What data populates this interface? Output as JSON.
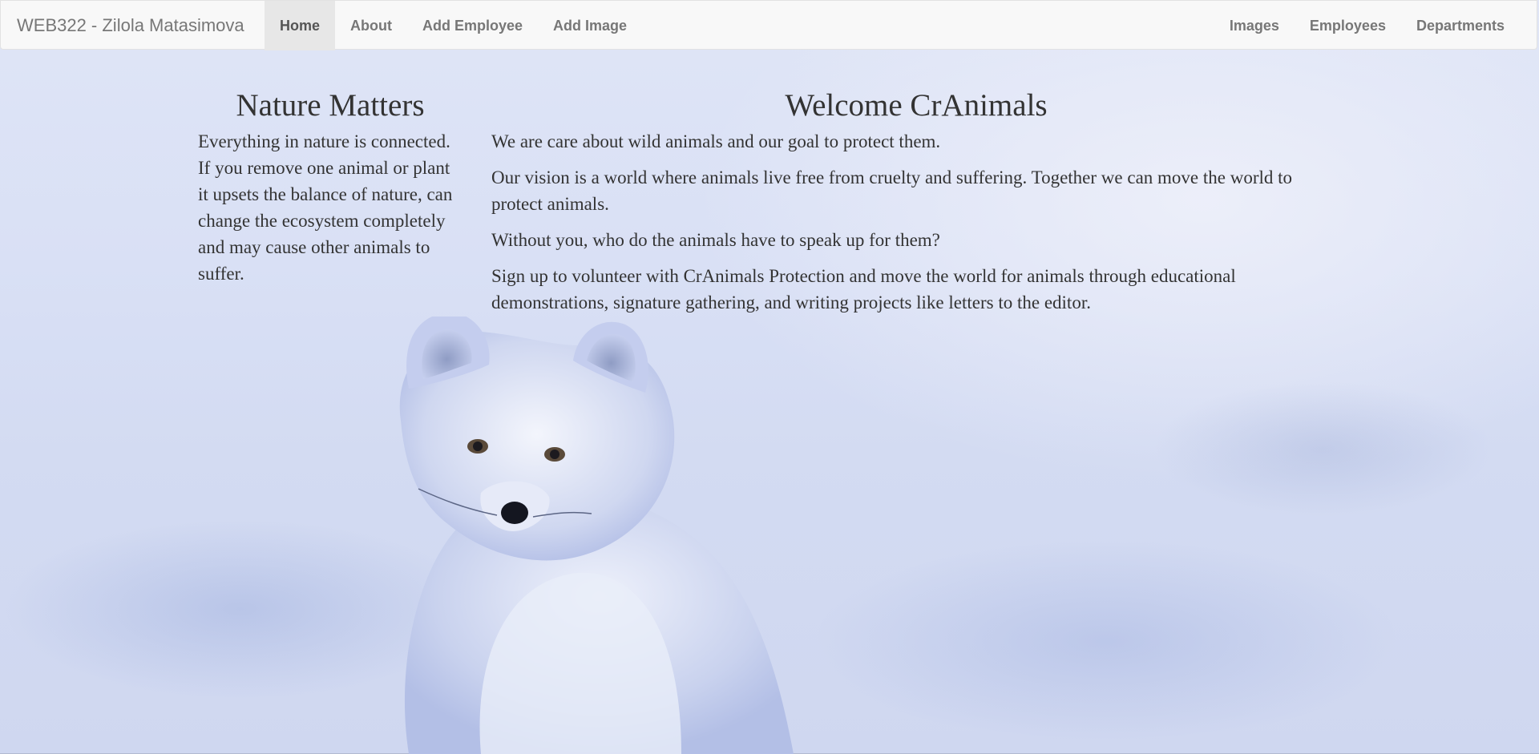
{
  "navbar": {
    "brand": "WEB322 - Zilola Matasimova",
    "left_links": [
      {
        "label": "Home",
        "active": true
      },
      {
        "label": "About",
        "active": false
      },
      {
        "label": "Add Employee",
        "active": false
      },
      {
        "label": "Add Image",
        "active": false
      }
    ],
    "right_links": [
      {
        "label": "Images"
      },
      {
        "label": "Employees"
      },
      {
        "label": "Departments"
      }
    ]
  },
  "left_column": {
    "heading": "Nature Matters",
    "paragraph": "Everything in nature is connected. If you remove one animal or plant it upsets the balance of nature, can change the ecosystem completely and may cause other animals to suffer."
  },
  "right_column": {
    "heading": "Welcome CrAnimals",
    "paragraphs": [
      "We are care about wild animals and our goal to protect them.",
      "Our vision is a world where animals live free from cruelty and suffering. Together we can move the world to protect animals.",
      "Without you, who do the animals have to speak up for them?",
      "Sign up to volunteer with CrAnimals Protection and move the world for animals through educational demonstrations, signature gathering, and writing projects like letters to the editor."
    ]
  },
  "background": {
    "image": "arctic-fox-in-snow",
    "tint": "#d9e0f5"
  }
}
